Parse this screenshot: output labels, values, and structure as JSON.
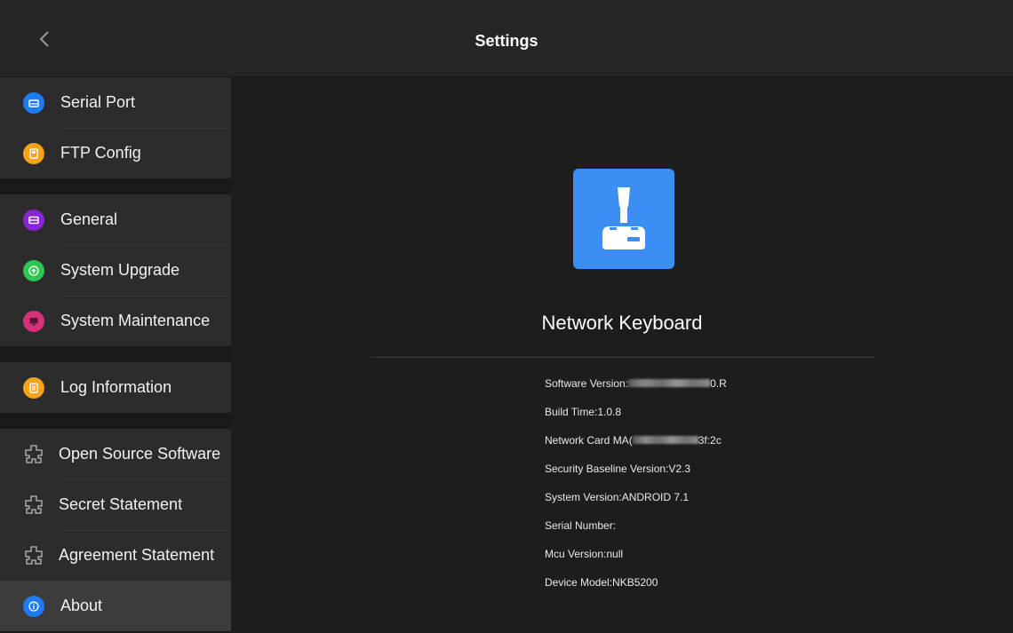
{
  "header": {
    "title": "Settings"
  },
  "sidebar": {
    "groups": [
      [
        {
          "label": "Serial Port",
          "icon": "serial-port-icon",
          "color": "#1e7cf2"
        },
        {
          "label": "FTP Config",
          "icon": "ftp-config-icon",
          "color": "#f5a31a"
        }
      ],
      [
        {
          "label": "General",
          "icon": "general-icon",
          "color": "#8a24d8"
        },
        {
          "label": "System Upgrade",
          "icon": "system-upgrade-icon",
          "color": "#2dc653"
        },
        {
          "label": "System Maintenance",
          "icon": "system-maintenance-icon",
          "color": "#d8307a"
        }
      ],
      [
        {
          "label": "Log Information",
          "icon": "log-information-icon",
          "color": "#f5a31a"
        }
      ],
      [
        {
          "label": "Open Source Software",
          "icon": "puzzle-icon"
        },
        {
          "label": "Secret Statement",
          "icon": "puzzle-icon"
        },
        {
          "label": "Agreement Statement",
          "icon": "puzzle-icon"
        },
        {
          "label": "About",
          "icon": "info-icon",
          "color": "#1e7cf2",
          "selected": true
        }
      ]
    ]
  },
  "about": {
    "app_name": "Network Keyboard",
    "logo_color": "#3b8ef2",
    "info": [
      {
        "label": "Software Version:",
        "value": "0.R"
      },
      {
        "label": "Build Time:1.0.8",
        "value": ""
      },
      {
        "label": "Network Card MA(",
        "value": "3f:2c"
      },
      {
        "label": "Security Baseline Version:V2.3",
        "value": ""
      },
      {
        "label": "System Version:ANDROID 7.1",
        "value": ""
      },
      {
        "label": "Serial Number:",
        "value": ""
      },
      {
        "label": "Mcu Version:null",
        "value": ""
      },
      {
        "label": "Device Model:NKB5200",
        "value": ""
      }
    ]
  }
}
